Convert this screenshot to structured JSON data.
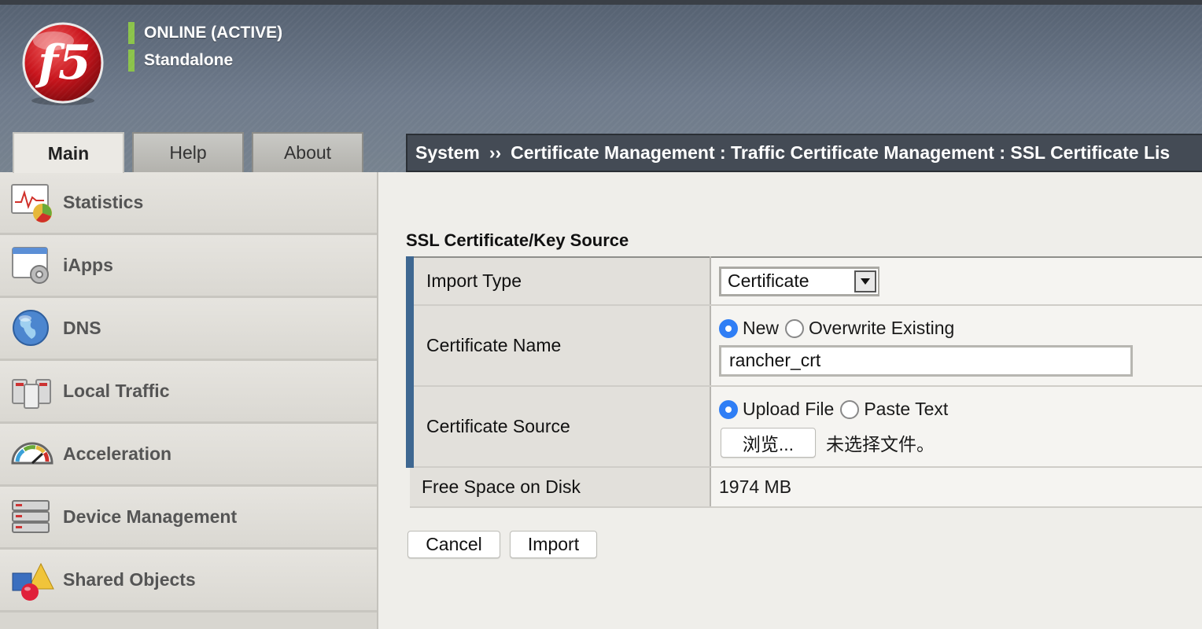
{
  "header": {
    "status_lines": [
      "ONLINE (ACTIVE)",
      "Standalone"
    ],
    "status_color": "#8bc34a"
  },
  "tabs": [
    {
      "label": "Main",
      "active": true
    },
    {
      "label": "Help",
      "active": false
    },
    {
      "label": "About",
      "active": false
    }
  ],
  "breadcrumb": {
    "root": "System",
    "separator": "››",
    "path": "Certificate Management : Traffic Certificate Management : SSL Certificate Lis"
  },
  "sidebar": {
    "items": [
      {
        "label": "Statistics",
        "icon": "statistics-icon"
      },
      {
        "label": "iApps",
        "icon": "iapps-icon"
      },
      {
        "label": "DNS",
        "icon": "dns-globe-icon"
      },
      {
        "label": "Local Traffic",
        "icon": "local-traffic-icon"
      },
      {
        "label": "Acceleration",
        "icon": "acceleration-gauge-icon"
      },
      {
        "label": "Device Management",
        "icon": "device-management-icon"
      },
      {
        "label": "Shared Objects",
        "icon": "shared-objects-icon"
      }
    ]
  },
  "form": {
    "section_title": "SSL Certificate/Key Source",
    "import_type": {
      "label": "Import Type",
      "value": "Certificate"
    },
    "certificate_name": {
      "label": "Certificate Name",
      "option_new": "New",
      "option_overwrite": "Overwrite Existing",
      "selected": "New",
      "value": "rancher_crt"
    },
    "certificate_source": {
      "label": "Certificate Source",
      "option_upload": "Upload File",
      "option_paste": "Paste Text",
      "selected": "Upload File",
      "browse_label": "浏览...",
      "file_status": "未选择文件。"
    },
    "free_space": {
      "label": "Free Space on Disk",
      "value": "1974 MB"
    }
  },
  "actions": {
    "cancel_label": "Cancel",
    "import_label": "Import"
  },
  "colors": {
    "accent_bar": "#3e6791",
    "radio_selected": "#2f7ef5",
    "breadcrumb_bg": "#444b55"
  }
}
